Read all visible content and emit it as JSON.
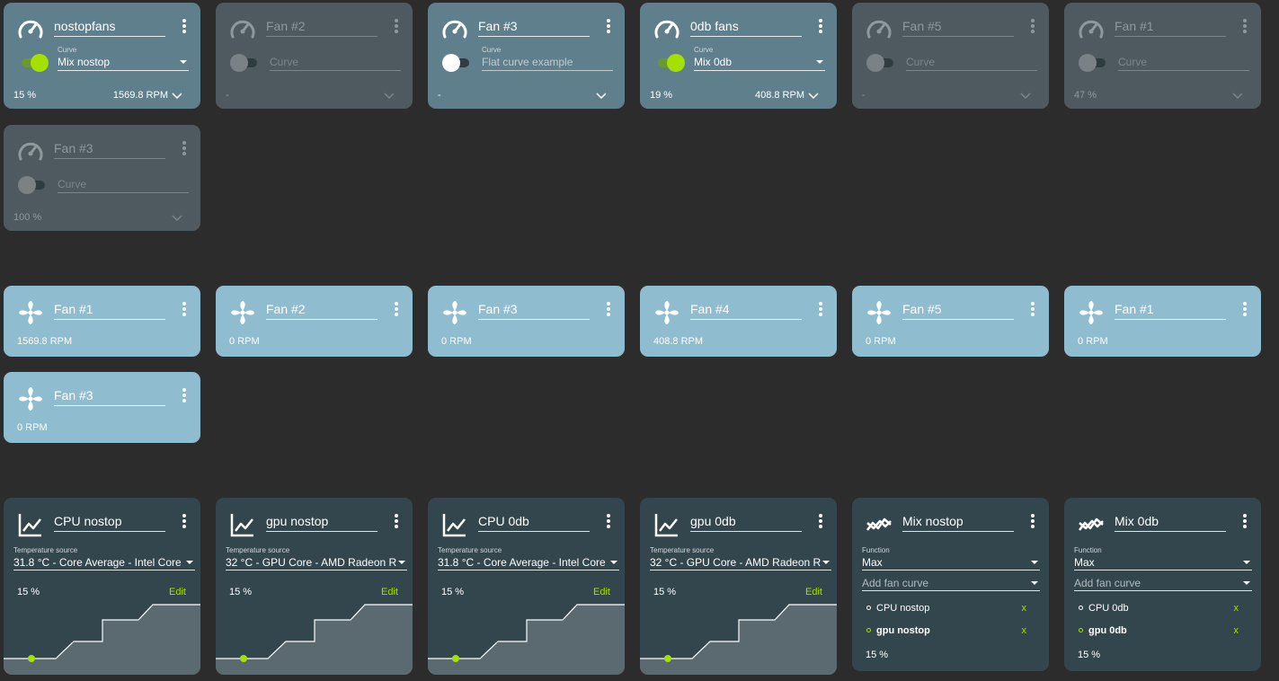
{
  "controls": [
    {
      "name": "nostopfans",
      "enabled": true,
      "toggle": "on",
      "curve_label": "Curve",
      "curve": "Mix nostop",
      "pct": "15 %",
      "rpm": "1569.8 RPM"
    },
    {
      "name": "Fan #2",
      "enabled": false,
      "toggle": "grey",
      "curve_label": "",
      "curve": "Curve",
      "pct": "-",
      "rpm": ""
    },
    {
      "name": "Fan #3",
      "enabled": true,
      "dim": true,
      "toggle": "white",
      "curve_label": "Curve",
      "curve": "Flat curve example",
      "pct": "-",
      "rpm": ""
    },
    {
      "name": "0db fans",
      "enabled": true,
      "toggle": "on",
      "curve_label": "Curve",
      "curve": "Mix 0db",
      "pct": "19 %",
      "rpm": "408.8 RPM"
    },
    {
      "name": "Fan #5",
      "enabled": false,
      "toggle": "grey",
      "curve_label": "",
      "curve": "Curve",
      "pct": "-",
      "rpm": ""
    },
    {
      "name": "Fan #1",
      "enabled": false,
      "toggle": "grey",
      "curve_label": "",
      "curve": "Curve",
      "pct": "47 %",
      "rpm": ""
    },
    {
      "name": "Fan #3",
      "enabled": false,
      "toggle": "grey",
      "curve_label": "",
      "curve": "Curve",
      "pct": "100 %",
      "rpm": ""
    }
  ],
  "speeds": [
    {
      "name": "Fan #1",
      "rpm": "1569.8 RPM"
    },
    {
      "name": "Fan #2",
      "rpm": "0 RPM"
    },
    {
      "name": "Fan #3",
      "rpm": "0 RPM"
    },
    {
      "name": "Fan #4",
      "rpm": "408.8 RPM"
    },
    {
      "name": "Fan #5",
      "rpm": "0 RPM"
    },
    {
      "name": "Fan #1",
      "rpm": "0 RPM"
    },
    {
      "name": "Fan #3",
      "rpm": "0 RPM"
    }
  ],
  "curves": [
    {
      "name": "CPU nostop",
      "source_label": "Temperature source",
      "source": "31.8 °C - Core Average - Intel Core",
      "pct": "15 %",
      "edit": "Edit"
    },
    {
      "name": "gpu nostop",
      "source_label": "Temperature source",
      "source": "32 °C - GPU Core - AMD Radeon R",
      "pct": "15 %",
      "edit": "Edit"
    },
    {
      "name": "CPU 0db",
      "source_label": "Temperature source",
      "source": "31.8 °C - Core Average - Intel Core",
      "pct": "15 %",
      "edit": "Edit"
    },
    {
      "name": "gpu 0db",
      "source_label": "Temperature source",
      "source": "32 °C - GPU Core - AMD Radeon R",
      "pct": "15 %",
      "edit": "Edit"
    }
  ],
  "mixes": [
    {
      "name": "Mix nostop",
      "function_label": "Function",
      "function": "Max",
      "add": "Add fan curve",
      "items": [
        {
          "label": "CPU nostop",
          "bold": false,
          "remove": "x"
        },
        {
          "label": "gpu nostop",
          "bold": true,
          "remove": "x"
        }
      ],
      "pct": "15 %"
    },
    {
      "name": "Mix 0db",
      "function_label": "Function",
      "function": "Max",
      "add": "Add fan curve",
      "items": [
        {
          "label": "CPU 0db",
          "bold": false,
          "remove": "x"
        },
        {
          "label": "gpu 0db",
          "bold": true,
          "remove": "x"
        }
      ],
      "pct": "15 %"
    }
  ],
  "colors": {
    "accent": "#a4e000",
    "control_card": "#5f7f8c",
    "control_card_off": "#4f5a60",
    "speed_card": "#8fbccf",
    "curve_card": "#33454d",
    "background": "#2c2c2c"
  },
  "icons": {
    "control": "gauge-icon",
    "speed": "fan-icon",
    "curve": "graph-icon",
    "mix": "mix-icon",
    "menu": "more-vert-icon",
    "expand": "chevron-down-icon"
  }
}
